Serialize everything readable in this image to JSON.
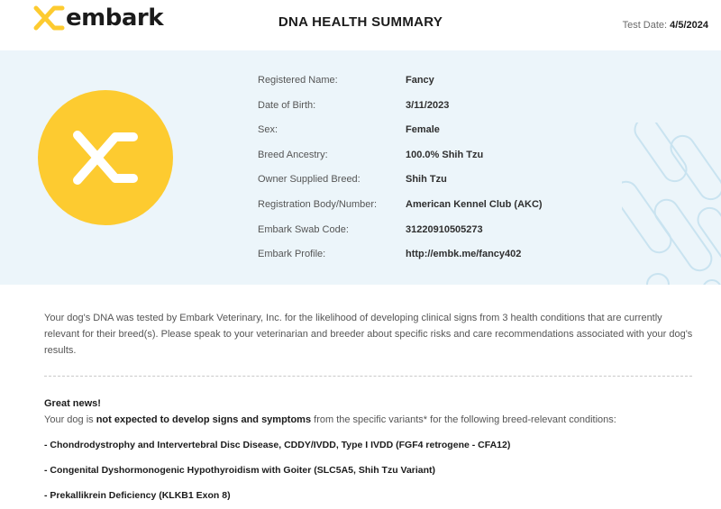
{
  "header": {
    "brand_name": "embark",
    "title": "DNA HEALTH SUMMARY",
    "test_date_label": "Test Date:",
    "test_date_value": "4/5/2024"
  },
  "colors": {
    "brand_yellow": "#fdcb30",
    "band_background": "#ecf5fa"
  },
  "icons": {
    "brand": "embark-logo-icon",
    "avatar": "embark-mark-icon"
  },
  "profile_fields": [
    {
      "label": "Registered Name:",
      "value": "Fancy"
    },
    {
      "label": "Date of Birth:",
      "value": "3/11/2023"
    },
    {
      "label": "Sex:",
      "value": "Female"
    },
    {
      "label": "Breed Ancestry:",
      "value": "100.0% Shih Tzu"
    },
    {
      "label": "Owner Supplied Breed:",
      "value": "Shih Tzu"
    },
    {
      "label": "Registration Body/Number:",
      "value": "American Kennel Club (AKC)"
    },
    {
      "label": "Embark Swab Code:",
      "value": "31220910505273"
    },
    {
      "label": "Embark Profile:",
      "value": "http://embk.me/fancy402"
    }
  ],
  "intro": "Your dog's DNA was tested by Embark Veterinary, Inc. for the likelihood of developing clinical signs from 3 health conditions that are currently relevant for their breed(s). Please speak to your veterinarian and breeder about specific risks and care recommendations associated with your dog's results.",
  "result": {
    "greeting": "Great news!",
    "summary_prefix": "Your dog is ",
    "summary_emphasis": "not expected to develop signs and symptoms",
    "summary_suffix": " from the specific variants* for the following breed-relevant conditions:",
    "conditions": [
      "- Chondrodystrophy and Intervertebral Disc Disease, CDDY/IVDD, Type I IVDD (FGF4 retrogene - CFA12)",
      "- Congenital Dyshormonogenic Hypothyroidism with Goiter (SLC5A5, Shih Tzu Variant)",
      "- Prekallikrein Deficiency (KLKB1 Exon 8)"
    ]
  }
}
